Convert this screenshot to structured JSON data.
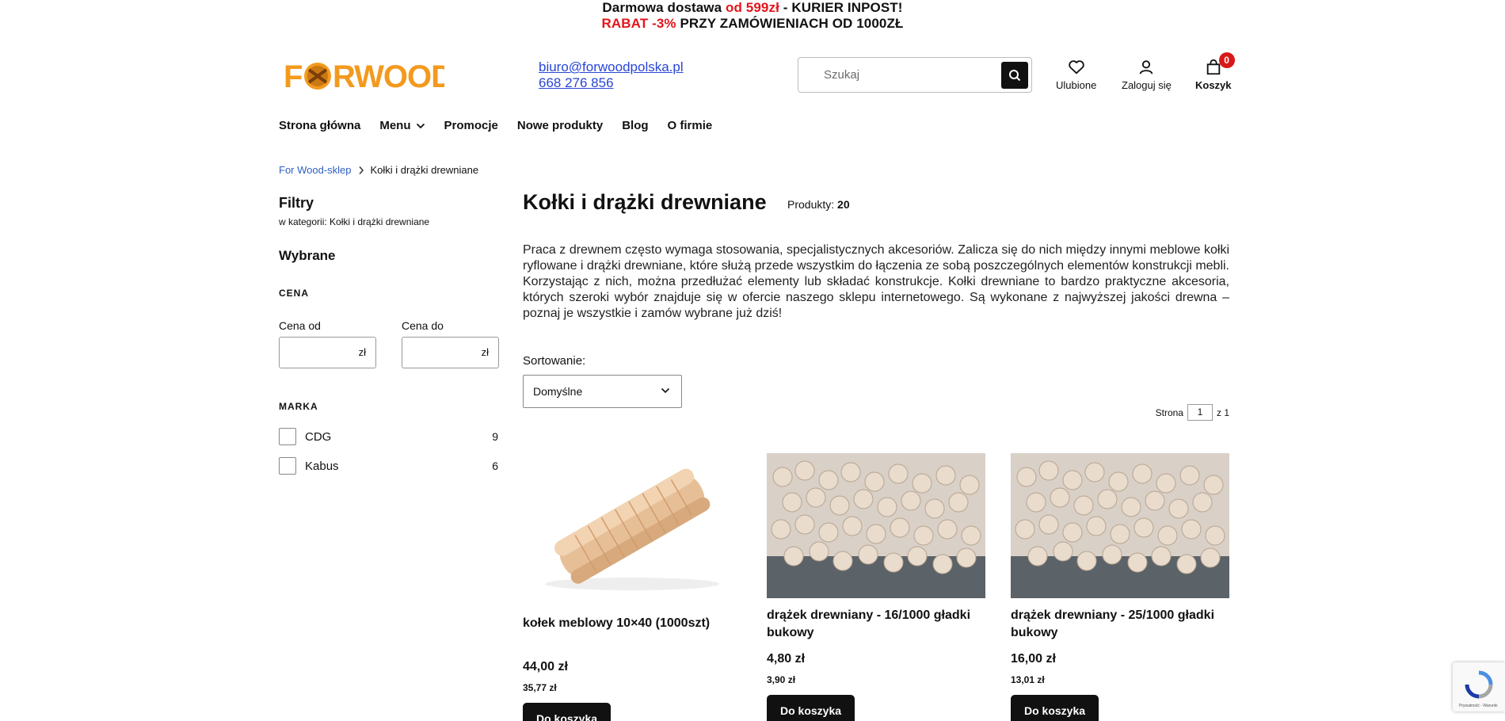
{
  "promo": {
    "line1_a": "Darmowa dostawa ",
    "line1_b": "od 599zł",
    "line1_c": " - KURIER INPOST!",
    "line2_a": "RABAT -3% ",
    "line2_b": " PRZY ZAMÓWIENIACH OD 1000ZŁ"
  },
  "logo": {
    "text": "FORWOOD"
  },
  "contact": {
    "email": "biuro@forwoodpolska.pl",
    "phone": "668 276 856"
  },
  "search": {
    "placeholder": "Szukaj"
  },
  "header_icons": {
    "favorites": "Ulubione",
    "login": "Zaloguj się",
    "cart": "Koszyk",
    "cart_count": "0"
  },
  "nav": {
    "home": "Strona główna",
    "menu": "Menu",
    "promotions": "Promocje",
    "new_products": "Nowe produkty",
    "blog": "Blog",
    "about": "O firmie"
  },
  "breadcrumb": {
    "root": "For Wood-sklep",
    "current": "Kołki i drążki drewniane"
  },
  "sidebar": {
    "title": "Filtry",
    "subtitle": "w kategorii: Kołki i drążki drewniane",
    "selected": "Wybrane",
    "price_section": "CENA",
    "price_from": "Cena od",
    "price_to": "Cena do",
    "currency": "zł",
    "brand_section": "MARKA",
    "brands": [
      {
        "name": "CDG",
        "count": "9"
      },
      {
        "name": "Kabus",
        "count": "6"
      }
    ]
  },
  "main": {
    "title": "Kołki i drążki drewniane",
    "products_label": "Produkty:",
    "products_count": "20",
    "description": "Praca z drewnem często wymaga stosowania, specjalistycznych akcesoriów. Zalicza się do nich między innymi meblowe kołki ryflowane i drążki drewniane, które służą przede wszystkim do łączenia ze sobą poszczególnych elementów konstrukcji mebli. Korzystając z nich, można przedłużać elementy lub składać konstrukcje. Kołki drewniane to bardzo praktyczne akcesoria, których szeroki wybór znajduje się w ofercie naszego sklepu internetowego. Są wykonane z najwyższej jakości drewna – poznaj je wszystkie i zamów wybrane już dziś!",
    "sort_label": "Sortowanie:",
    "sort_value": "Domyślne",
    "page_label": "Strona",
    "page_value": "1",
    "page_of": "z 1"
  },
  "products": [
    {
      "name": "kołek meblowy 10×40 (1000szt)",
      "price": "44,00 zł",
      "net": "35,77 zł",
      "cart": "Do koszyka"
    },
    {
      "name": "drążek drewniany - 16/1000 gładki bukowy",
      "price": "4,80 zł",
      "net": "3,90 zł",
      "cart": "Do koszyka"
    },
    {
      "name": "drążek drewniany - 25/1000 gładki bukowy",
      "price": "16,00 zł",
      "net": "13,01 zł",
      "cart": "Do koszyka"
    }
  ],
  "recaptcha": {
    "text": "Prywatność - Warunki"
  }
}
